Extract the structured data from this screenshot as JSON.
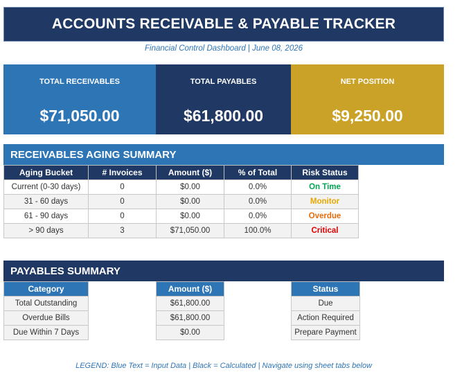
{
  "header": {
    "title": "ACCOUNTS RECEIVABLE & PAYABLE TRACKER",
    "subtitle": "Financial Control Dashboard  |  June 08, 2026"
  },
  "kpis": [
    {
      "label": "TOTAL RECEIVABLES",
      "value": "$71,050.00",
      "color": "#2e75b6"
    },
    {
      "label": "TOTAL PAYABLES",
      "value": "$61,800.00",
      "color": "#1f3864"
    },
    {
      "label": "NET POSITION",
      "value": "$9,250.00",
      "color": "#c9a227"
    }
  ],
  "aging": {
    "section_title": "RECEIVABLES AGING SUMMARY",
    "headers": [
      "Aging Bucket",
      "# Invoices",
      "Amount ($)",
      "% of Total",
      "Risk Status"
    ],
    "rows": [
      {
        "bucket": "Current  (0-30 days)",
        "invoices": "0",
        "amount": "$0.00",
        "pct": "0.0%",
        "status": "On Time",
        "status_color": "#00a651"
      },
      {
        "bucket": "31 - 60 days",
        "invoices": "0",
        "amount": "$0.00",
        "pct": "0.0%",
        "status": "Monitor",
        "status_color": "#e6a800"
      },
      {
        "bucket": "61 - 90 days",
        "invoices": "0",
        "amount": "$0.00",
        "pct": "0.0%",
        "status": "Overdue",
        "status_color": "#e46c0a"
      },
      {
        "bucket": "> 90 days",
        "invoices": "3",
        "amount": "$71,050.00",
        "pct": "100.0%",
        "status": "Critical",
        "status_color": "#e00000"
      }
    ]
  },
  "payables": {
    "section_title": "PAYABLES SUMMARY",
    "category_header": "Category",
    "amount_header": "Amount ($)",
    "status_header": "Status",
    "rows": [
      {
        "category": "Total Outstanding",
        "amount": "$61,800.00",
        "status": "Due"
      },
      {
        "category": "Overdue Bills",
        "amount": "$61,800.00",
        "status": "Action Required"
      },
      {
        "category": "Due Within 7 Days",
        "amount": "$0.00",
        "status": "Prepare Payment"
      }
    ]
  },
  "legend": "LEGEND:  Blue Text = Input Data  |  Black = Calculated  |  Navigate using sheet tabs below"
}
